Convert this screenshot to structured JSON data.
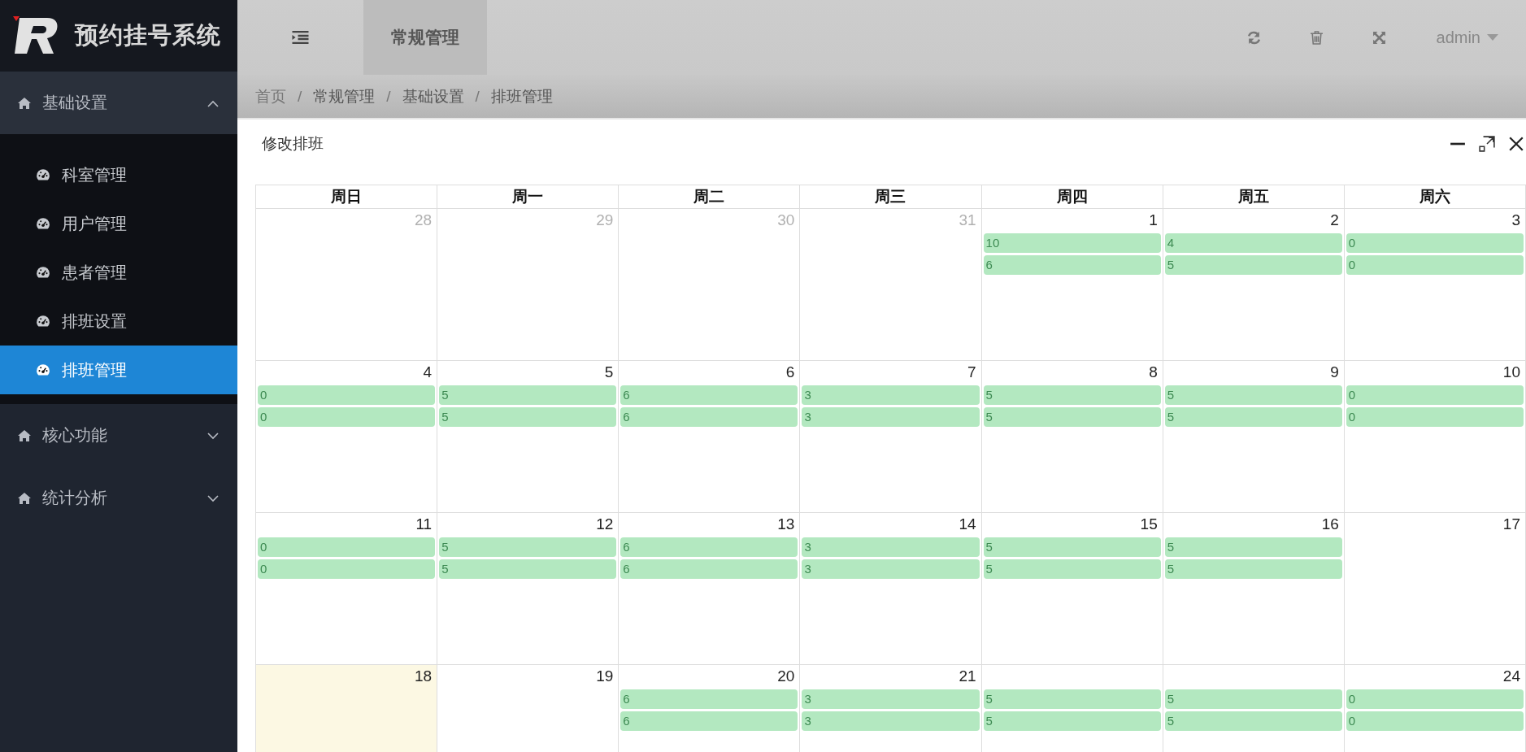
{
  "sidebar": {
    "logo_text": "预约挂号系统",
    "menu": [
      {
        "label": "基础设置",
        "expanded": true,
        "children": [
          {
            "label": "科室管理",
            "selected": false
          },
          {
            "label": "用户管理",
            "selected": false
          },
          {
            "label": "患者管理",
            "selected": false
          },
          {
            "label": "排班设置",
            "selected": false
          },
          {
            "label": "排班管理",
            "selected": true
          }
        ]
      },
      {
        "label": "核心功能",
        "expanded": false
      },
      {
        "label": "统计分析",
        "expanded": false
      }
    ]
  },
  "header": {
    "tabs": [
      {
        "label": "常规管理",
        "selected": true
      }
    ],
    "user": "admin"
  },
  "breadcrumb": {
    "separator": "/",
    "items": [
      "首页",
      "常规管理",
      "基础设置",
      "排班管理"
    ]
  },
  "panel": {
    "title": "修改排班"
  },
  "calendar": {
    "weekdays": [
      "周日",
      "周一",
      "周二",
      "周三",
      "周四",
      "周五",
      "周六"
    ],
    "weeks": [
      [
        {
          "day": "28",
          "other_month": true,
          "today": false
        },
        {
          "day": "29",
          "other_month": true,
          "today": false
        },
        {
          "day": "30",
          "other_month": true,
          "today": false
        },
        {
          "day": "31",
          "other_month": true,
          "today": false
        },
        {
          "day": "1",
          "other_month": false,
          "today": false,
          "events": [
            "10",
            "6"
          ]
        },
        {
          "day": "2",
          "other_month": false,
          "today": false,
          "events": [
            "4",
            "5"
          ]
        },
        {
          "day": "3",
          "other_month": false,
          "today": false,
          "events": [
            "0",
            "0"
          ]
        }
      ],
      [
        {
          "day": "4",
          "other_month": false,
          "today": false,
          "events": [
            "0",
            "0"
          ]
        },
        {
          "day": "5",
          "other_month": false,
          "today": false,
          "events": [
            "5",
            "5"
          ]
        },
        {
          "day": "6",
          "other_month": false,
          "today": false,
          "events": [
            "6",
            "6"
          ]
        },
        {
          "day": "7",
          "other_month": false,
          "today": false,
          "events": [
            "3",
            "3"
          ]
        },
        {
          "day": "8",
          "other_month": false,
          "today": false,
          "events": [
            "5",
            "5"
          ]
        },
        {
          "day": "9",
          "other_month": false,
          "today": false,
          "events": [
            "5",
            "5"
          ]
        },
        {
          "day": "10",
          "other_month": false,
          "today": false,
          "events": [
            "0",
            "0"
          ]
        }
      ],
      [
        {
          "day": "11",
          "other_month": false,
          "today": false,
          "events": [
            "0",
            "0"
          ]
        },
        {
          "day": "12",
          "other_month": false,
          "today": false,
          "events": [
            "5",
            "5"
          ]
        },
        {
          "day": "13",
          "other_month": false,
          "today": false,
          "events": [
            "6",
            "6"
          ]
        },
        {
          "day": "14",
          "other_month": false,
          "today": false,
          "events": [
            "3",
            "3"
          ]
        },
        {
          "day": "15",
          "other_month": false,
          "today": false,
          "events": [
            "5",
            "5"
          ]
        },
        {
          "day": "16",
          "other_month": false,
          "today": false,
          "events": [
            "5",
            "5"
          ]
        },
        {
          "day": "17",
          "other_month": false,
          "today": false
        }
      ],
      [
        {
          "day": "18",
          "other_month": false,
          "today": true
        },
        {
          "day": "19",
          "other_month": false,
          "today": false
        },
        {
          "day": "20",
          "other_month": false,
          "today": false,
          "events": [
            "6",
            "6"
          ]
        },
        {
          "day": "21",
          "other_month": false,
          "today": false,
          "events": [
            "3",
            "3"
          ]
        },
        {
          "today": false,
          "events": [
            "5",
            "5"
          ]
        },
        {
          "today": false,
          "events": [
            "5",
            "5"
          ]
        },
        {
          "day": "24",
          "other_month": false,
          "today": false,
          "events": [
            "0",
            "0"
          ]
        }
      ]
    ]
  }
}
